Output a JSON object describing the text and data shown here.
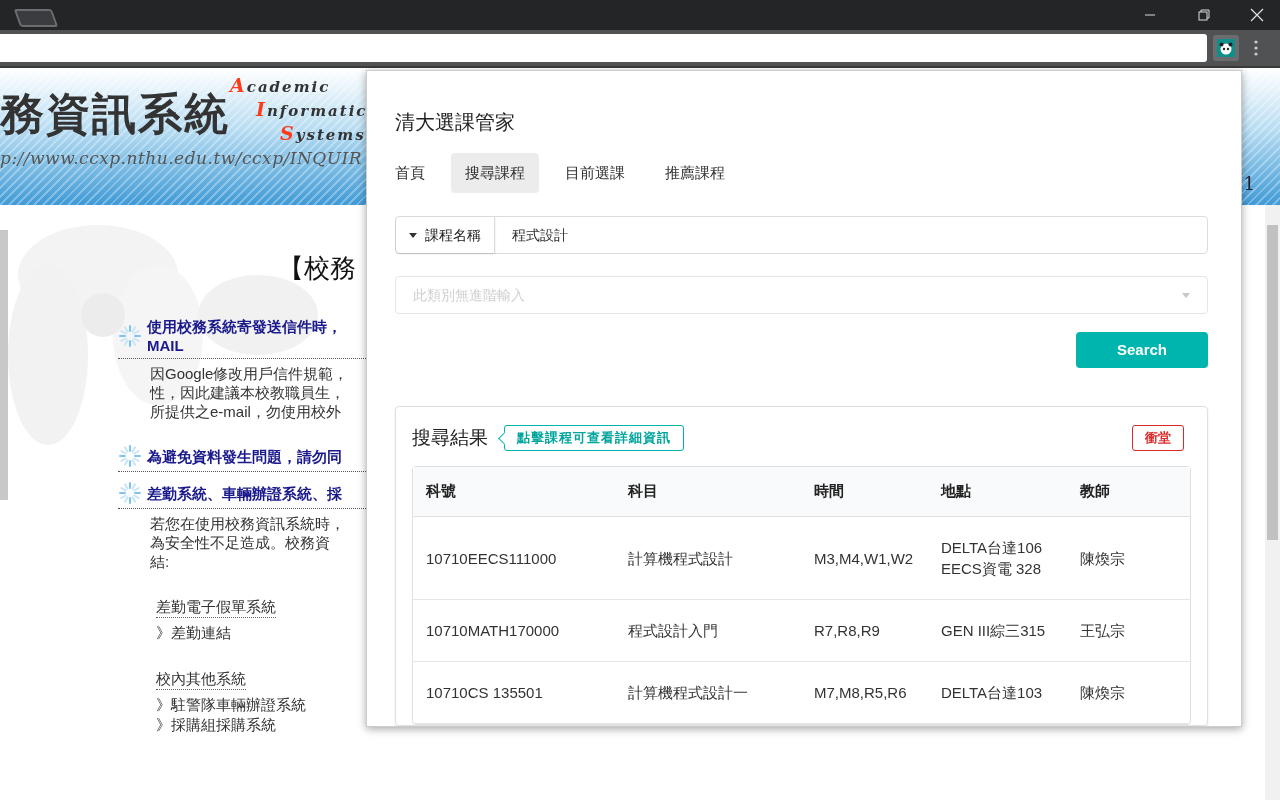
{
  "banner": {
    "title": "務資訊系統",
    "words": [
      {
        "initial": "A",
        "rest": "cademic"
      },
      {
        "initial": "I",
        "rest": "nformatic"
      },
      {
        "initial": "S",
        "rest": "ystems"
      }
    ],
    "url": "p://www.ccxp.nthu.edu.tw/ccxp/INQUIR",
    "edge_text": "1"
  },
  "page": {
    "heading": "【校務",
    "sections": [
      {
        "kind": "notice",
        "lines": [
          "使用校務系統寄發送信件時，",
          "MAIL"
        ]
      },
      {
        "kind": "body",
        "lines": [
          "因Google修改用戶信件規範，",
          "性，因此建議本校教職員生，",
          "所提供之e-mail，勿使用校外"
        ]
      },
      {
        "kind": "notice",
        "lines": [
          "為避免資料發生問題，請勿同"
        ]
      },
      {
        "kind": "notice",
        "lines": [
          "差勤系統、車輛辦證系統、採"
        ]
      },
      {
        "kind": "body",
        "lines": [
          "若您在使用校務資訊系統時，",
          "為安全性不足造成。校務資",
          "結:"
        ]
      }
    ],
    "link_groups": [
      {
        "title": "差勤電子假單系統",
        "links": [
          "》差勤連結"
        ]
      },
      {
        "title": "校內其他系統",
        "links": [
          "》駐警隊車輛辦證系統",
          "》採購組採購系統"
        ]
      }
    ]
  },
  "popup": {
    "title": "清大選課管家",
    "tabs": [
      {
        "label": "首頁",
        "selected": false
      },
      {
        "label": "搜尋課程",
        "selected": true
      },
      {
        "label": "目前選課",
        "selected": false
      },
      {
        "label": "推薦課程",
        "selected": false
      }
    ],
    "search": {
      "field_type": "課程名稱",
      "value": "程式設計",
      "advanced_placeholder": "此類別無進階輸入",
      "advanced_disabled": true,
      "button": "Search"
    },
    "results": {
      "title": "搜尋結果",
      "hint": "點擊課程可查看詳細資訊",
      "conflict_badge": "衝堂",
      "columns": [
        "科號",
        "科目",
        "時間",
        "地點",
        "教師"
      ],
      "rows": [
        {
          "code": "10710EECS111000",
          "name": "計算機程式設計",
          "time": "M3,M4,W1,W2",
          "location": [
            "DELTA台達106",
            "EECS資電 328"
          ],
          "teacher": "陳煥宗"
        },
        {
          "code": "10710MATH170000",
          "name": "程式設計入門",
          "time": "R7,R8,R9",
          "location": [
            "GEN III綜三315"
          ],
          "teacher": "王弘宗"
        },
        {
          "code": "10710CS 135501",
          "name": "計算機程式設計一",
          "time": "M7,M8,R5,R6",
          "location": [
            "DELTA台達103"
          ],
          "teacher": "陳煥宗"
        }
      ]
    }
  }
}
